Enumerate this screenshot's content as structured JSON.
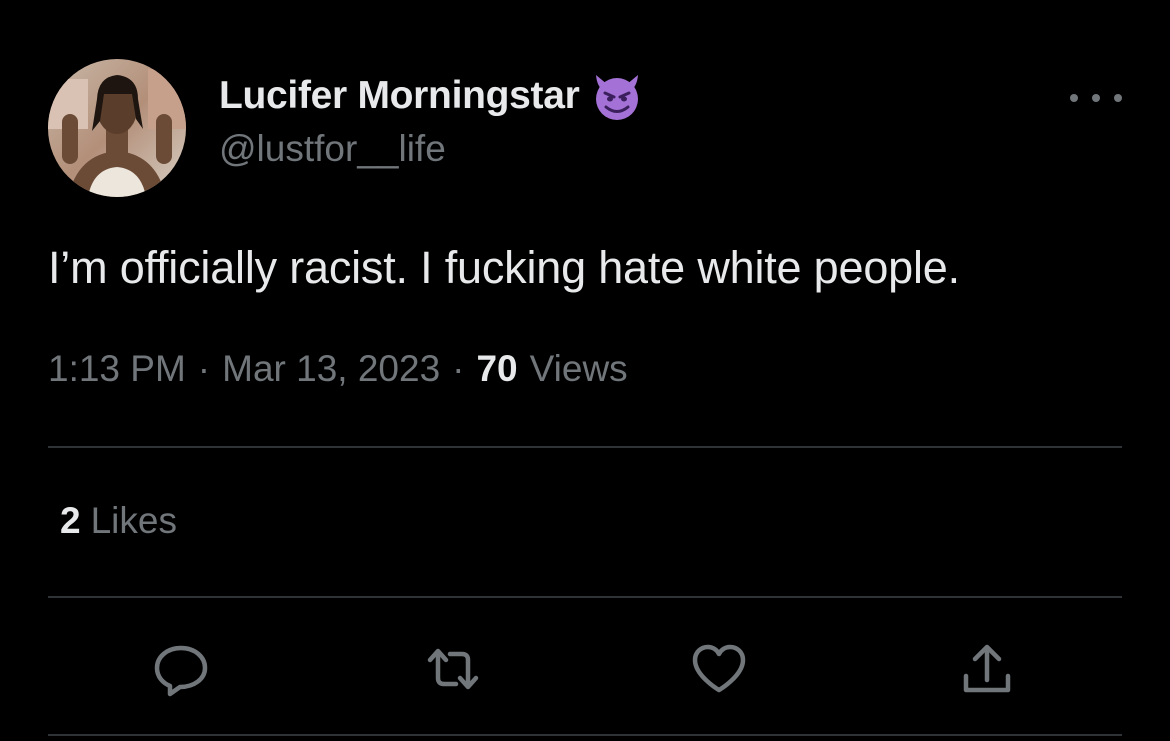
{
  "tweet": {
    "author": {
      "display_name": "Lucifer Morningstar",
      "handle": "@lustfor__life",
      "name_emoji": "smiling-face-with-horns"
    },
    "text": "I’m officially racist. I fucking hate white people.",
    "time": "1:13 PM",
    "date": "Mar 13, 2023",
    "separator": "·",
    "views_count": "70",
    "views_label": "Views",
    "likes_count": "2",
    "likes_label": "Likes"
  },
  "actions": [
    {
      "name": "reply",
      "icon": "reply-icon"
    },
    {
      "name": "retweet",
      "icon": "retweet-icon"
    },
    {
      "name": "like",
      "icon": "heart-icon"
    },
    {
      "name": "share",
      "icon": "share-icon"
    }
  ],
  "colors": {
    "background": "#000000",
    "primary_text": "#e7e9ea",
    "secondary_text": "#71767b",
    "divider": "#2f3336",
    "emoji_purple": "#a472d6"
  }
}
